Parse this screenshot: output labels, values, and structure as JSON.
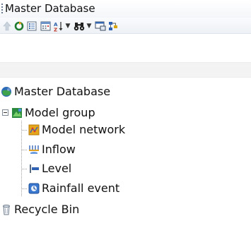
{
  "panel": {
    "title": "Master Database"
  },
  "toolbar": {
    "buttons": [
      {
        "icon": "up-arrow-icon"
      },
      {
        "icon": "refresh-icon"
      },
      {
        "icon": "properties-icon"
      },
      {
        "icon": "calendar-icon"
      },
      {
        "icon": "sort-icon",
        "has_dropdown": true
      },
      {
        "icon": "find-binoculars-icon",
        "has_dropdown": true
      },
      {
        "icon": "window-icon"
      },
      {
        "icon": "network-icon"
      }
    ]
  },
  "tree": {
    "root": {
      "label": "Master Database",
      "icon": "database-icon"
    },
    "group": {
      "label": "Model group",
      "icon": "model-group-icon",
      "expanded": true
    },
    "children": [
      {
        "label": "Model network",
        "icon": "model-network-icon"
      },
      {
        "label": "Inflow",
        "icon": "inflow-icon"
      },
      {
        "label": "Level",
        "icon": "level-icon"
      },
      {
        "label": "Rainfall event",
        "icon": "rainfall-event-icon"
      }
    ],
    "recycle": {
      "label": "Recycle Bin",
      "icon": "recycle-bin-icon"
    }
  }
}
